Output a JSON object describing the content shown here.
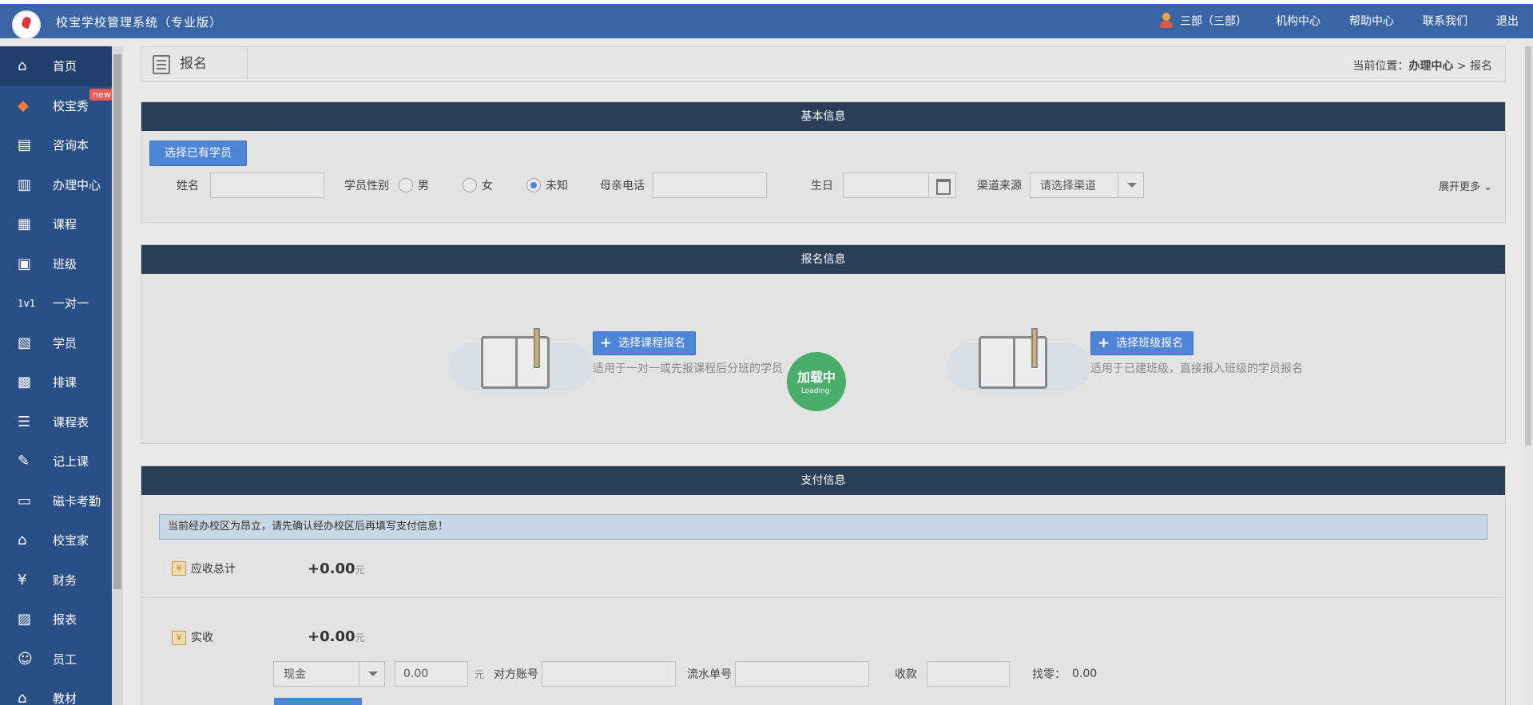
{
  "app": {
    "title": "校宝学校管理系统（专业版）",
    "user": "三部（三部）",
    "links": [
      "机构中心",
      "帮助中心",
      "联系我们",
      "退出"
    ]
  },
  "sidebar": {
    "items": [
      {
        "label": "首页",
        "icon": "home-icon",
        "active": true
      },
      {
        "label": "校宝秀",
        "icon": "xiaobao-show-icon",
        "badge": "new"
      },
      {
        "label": "咨询本",
        "icon": "consult-icon"
      },
      {
        "label": "办理中心",
        "icon": "handle-center-icon"
      },
      {
        "label": "课程",
        "icon": "course-icon"
      },
      {
        "label": "班级",
        "icon": "class-icon"
      },
      {
        "label": "一对一",
        "icon": "one-on-one-icon"
      },
      {
        "label": "学员",
        "icon": "student-icon"
      },
      {
        "label": "排课",
        "icon": "schedule-icon"
      },
      {
        "label": "课程表",
        "icon": "timetable-icon"
      },
      {
        "label": "记上课",
        "icon": "attendance-record-icon"
      },
      {
        "label": "磁卡考勤",
        "icon": "card-icon"
      },
      {
        "label": "校宝家",
        "icon": "family-icon"
      },
      {
        "label": "财务",
        "icon": "finance-icon"
      },
      {
        "label": "报表",
        "icon": "report-icon"
      },
      {
        "label": "员工",
        "icon": "staff-icon"
      },
      {
        "label": "教材",
        "icon": "material-icon"
      }
    ]
  },
  "page": {
    "title": "报名",
    "breadcrumb_prefix": "当前位置：",
    "breadcrumb_parent": "办理中心",
    "breadcrumb_sep": ">",
    "breadcrumb_current": "报名"
  },
  "basic": {
    "header": "基本信息",
    "pick_button": "选择已有学员",
    "name_label": "姓名",
    "gender_label": "学员性别",
    "gender_options": [
      "男",
      "女",
      "未知"
    ],
    "gender_selected": "未知",
    "mother_phone_label": "母亲电话",
    "birthday_label": "生日",
    "channel_label": "渠道来源",
    "channel_placeholder": "请选择渠道",
    "expand": "展开更多"
  },
  "enroll": {
    "header": "报名信息",
    "course_button": "选择课程报名",
    "course_hint": "适用于一对一或先报课程后分班的学员",
    "class_button": "选择班级报名",
    "class_hint": "适用于已建班级，直接报入班级的学员报名",
    "loading_cn": "加载中",
    "loading_en": "Loading·"
  },
  "pay": {
    "header": "支付信息",
    "notice": "当前经办校区为昂立，请先确认经办校区后再填写支付信息！",
    "receivable_label": "应收总计",
    "receivable_value": "+0.00",
    "unit": "元",
    "received_label": "实收",
    "received_value": "+0.00",
    "method": "现金",
    "amount": "0.00",
    "counter_account_label": "对方账号",
    "serial_label": "流水单号",
    "collect_label": "收款",
    "change_label": "找零：",
    "change_value": "0.00"
  },
  "colors": {
    "topbar": "#3a65a4",
    "sidebar": "#2a4f86",
    "panel_head": "#2b3e58",
    "primary_button": "#4f85d6",
    "loading": "#4aae6a"
  }
}
